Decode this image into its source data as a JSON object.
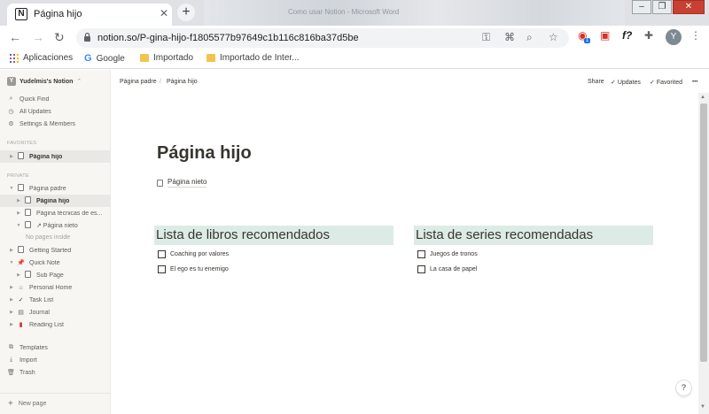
{
  "browser": {
    "tab_title": "Página hijo",
    "tab_icon": "N",
    "background_window_texts": [
      "Como usar Notion - Microsoft Word"
    ],
    "url": "notion.so/P-gina-hijo-f1805577b97649c1b116c816ba37d5be",
    "extension_badge": "1",
    "avatar_letter": "Y",
    "bookmarks": [
      "Aplicaciones",
      "Google",
      "Importado",
      "Importado de Inter..."
    ]
  },
  "sidebar": {
    "workspace": "Yudelmis's Notion",
    "workspace_icon": "Y",
    "top_items": [
      "Quick Find",
      "All Updates",
      "Settings & Members"
    ],
    "favorites_header": "FAVORITES",
    "favorites": [
      "Página hijo"
    ],
    "private_header": "PRIVATE",
    "private_items": [
      "Página padre",
      "Página hijo",
      "Página técnicas de es...",
      "↗ Página nieto",
      "No pages inside",
      "Getting Started",
      "Quick Note",
      "Sub Page",
      "Personal Home",
      "Task List",
      "Journal",
      "Reading List"
    ],
    "bottom_items": [
      "Templates",
      "Import",
      "Trash"
    ],
    "new_page": "New page"
  },
  "topbar": {
    "breadcrumbs": [
      "Página padre",
      "Página hijo"
    ],
    "separator": "/",
    "share": "Share",
    "updates": "Updates",
    "favorited": "Favorited",
    "more": "•••"
  },
  "page": {
    "title": "Página hijo",
    "subpage_link": "Página nieto",
    "columns": [
      {
        "heading": "Lista de libros recomendados",
        "todos": [
          "Coaching por valores",
          "El ego es tu enemigo"
        ]
      },
      {
        "heading": "Lista de series recomendadas",
        "todos": [
          "Juegos de tronos",
          "La casa de papel"
        ]
      }
    ],
    "help": "?"
  },
  "colors": {
    "heading_highlight": "#ddebe6",
    "sidebar_bg": "#f7f6f3",
    "text": "#37352f"
  }
}
